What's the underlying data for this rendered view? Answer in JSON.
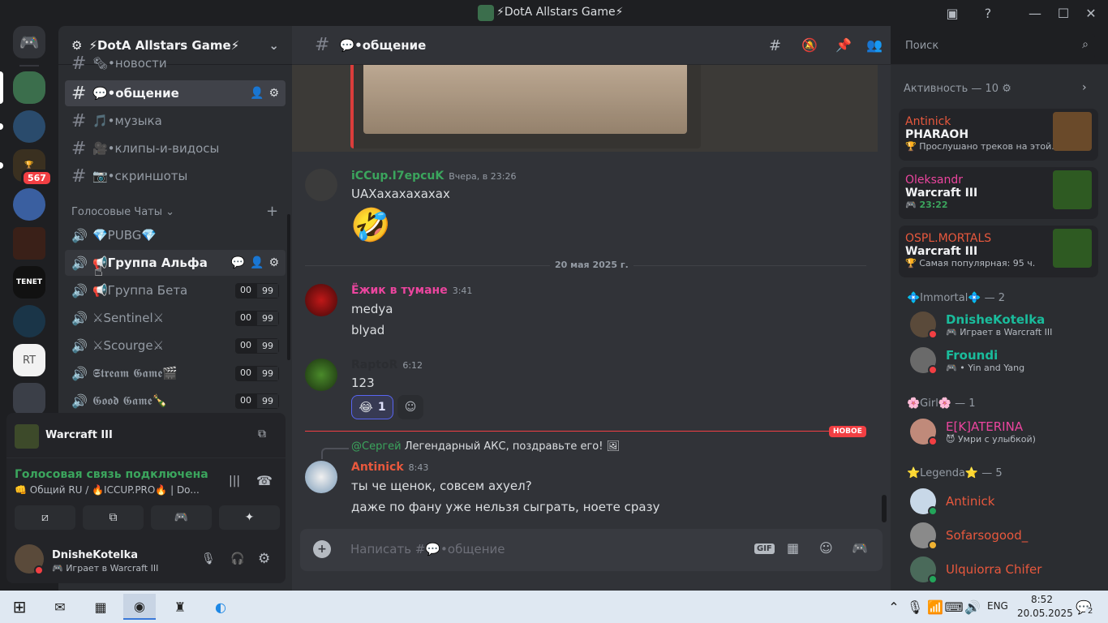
{
  "window": {
    "title": "⚡DotA Allstars Game⚡"
  },
  "guilds": {
    "badge_count": "567"
  },
  "server": {
    "name": "⚡DotA Allstars Game⚡"
  },
  "channels": [
    {
      "name": "🗞•новости"
    },
    {
      "name": "💬•общение"
    },
    {
      "name": "🎵•музыка"
    },
    {
      "name": "🎥•клипы-и-видосы"
    },
    {
      "name": "📷•скриншоты"
    }
  ],
  "voice_category": "Голосовые Чаты",
  "voice_channels": [
    {
      "name": "💎PUBG💎",
      "b1": "",
      "b2": ""
    },
    {
      "name": "📢Группа Альфа",
      "b1": "",
      "b2": ""
    },
    {
      "name": "📢Группа Бета",
      "b1": "00",
      "b2": "99"
    },
    {
      "name": "⚔Sentinel⚔",
      "b1": "00",
      "b2": "99"
    },
    {
      "name": "⚔Scourge⚔",
      "b1": "00",
      "b2": "99"
    },
    {
      "name": "𝕾𝖙𝖗𝖊𝖆𝖒 𝕲𝖆𝖒𝖊🎬",
      "b1": "00",
      "b2": "99"
    },
    {
      "name": "𝕲𝖔𝖔𝖉 𝕲𝖆𝖒𝖊🍾",
      "b1": "00",
      "b2": "99"
    }
  ],
  "activity_panel": {
    "game": "Warcraft III"
  },
  "voice_status": {
    "connected": "Голосовая связь подключена",
    "channel": "👊 Общий RU / 🔥ICCUP.PRO🔥 | Do..."
  },
  "user": {
    "name": "DnisheKotelka",
    "status": "Играет в Warcraft III"
  },
  "chat": {
    "channel": "💬•общение",
    "search_placeholder": "Поиск",
    "input_placeholder": "Написать #💬•общение",
    "date_divider": "20 мая 2025 г.",
    "new_label": "НОВОЕ",
    "messages": [
      {
        "author": "iCCup.I7epcuK",
        "time": "Вчера, в 23:26",
        "text": "UAXахахахахах",
        "emoji": "🤣",
        "color": "#3ba55d"
      },
      {
        "author": "Ёжик в тумане",
        "time": "3:41",
        "text": "medya",
        "text2": "blyad",
        "color": "#eb459e"
      },
      {
        "author": "RaptoR",
        "time": "6:12",
        "text": "123",
        "reaction": "😂",
        "reaction_count": "1",
        "color": "#2b2d31"
      },
      {
        "author": "Antinick",
        "time": "8:43",
        "reply_to": "@Сергей",
        "reply_text": "Легендарный АКС, поздравьте его!",
        "text": "ты че щенок, совсем ахуел?",
        "text2": "даже по фану уже нельзя сыграть, ноете сразу",
        "color": "#e8583d"
      }
    ]
  },
  "activity": {
    "header": "Активность — 10",
    "cards": [
      {
        "user": "Antinick",
        "title": "PHARAOH",
        "sub": "Прослушано треков на этой...",
        "user_color": "#e8583d"
      },
      {
        "user": "Oleksandr",
        "title": "Warcraft III",
        "sub": "23:22",
        "user_color": "#eb459e"
      },
      {
        "user": "OSPL.MORTALS",
        "title": "Warcraft III",
        "sub": "Самая популярная: 95 ч.",
        "user_color": "#e8583d"
      }
    ]
  },
  "member_groups": [
    {
      "label": "💠Immortal💠",
      "count": "— 2",
      "members": [
        {
          "name": "DnisheKotelka",
          "status": "Играет в Warcraft III",
          "color": "#1abc9c"
        },
        {
          "name": "Froundi",
          "status": "• Yin and Yang",
          "color": "#1abc9c"
        }
      ]
    },
    {
      "label": "🌸Girl🌸",
      "count": "— 1",
      "members": [
        {
          "name": "E[K]ATERINA",
          "status": "Умри с улыбкой)",
          "color": "#eb459e"
        }
      ]
    },
    {
      "label": "⭐Legenda⭐",
      "count": "— 5",
      "members": [
        {
          "name": "Antinick",
          "status": "",
          "color": "#e8583d"
        },
        {
          "name": "Sofarsogood_",
          "status": "",
          "color": "#e8583d"
        },
        {
          "name": "Ulquiorra Chifer",
          "status": "",
          "color": "#e8583d"
        }
      ]
    }
  ],
  "taskbar": {
    "lang": "ENG",
    "time": "8:52",
    "date": "20.05.2025",
    "notif": "2"
  }
}
